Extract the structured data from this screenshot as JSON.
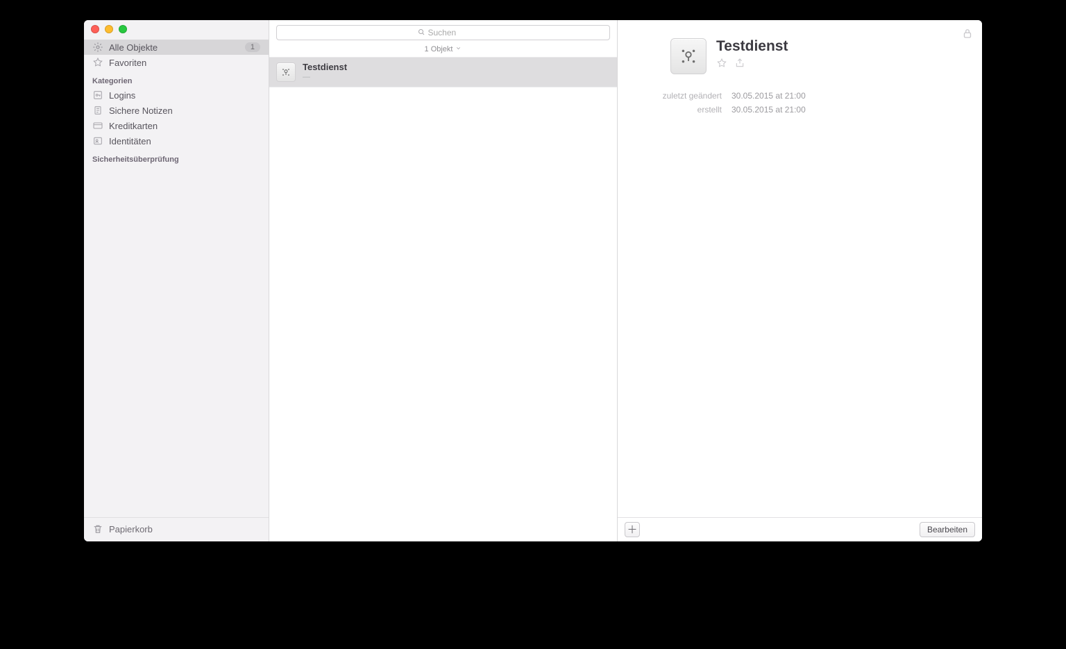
{
  "sidebar": {
    "all_items": {
      "label": "Alle Objekte",
      "count": "1"
    },
    "favorites": {
      "label": "Favoriten"
    },
    "categories_header": "Kategorien",
    "categories": {
      "logins": {
        "label": "Logins"
      },
      "secure_notes": {
        "label": "Sichere Notizen"
      },
      "credit_cards": {
        "label": "Kreditkarten"
      },
      "identities": {
        "label": "Identitäten"
      }
    },
    "security_audit_header": "Sicherheitsüberprüfung",
    "trash": {
      "label": "Papierkorb"
    }
  },
  "search": {
    "placeholder": "Suchen"
  },
  "list": {
    "count_label": "1 Objekt",
    "items": [
      {
        "title": "Testdienst",
        "subtitle": "—"
      }
    ]
  },
  "detail": {
    "title": "Testdienst",
    "modified": {
      "label": "zuletzt geändert",
      "value": "30.05.2015 at 21:00"
    },
    "created": {
      "label": "erstellt",
      "value": "30.05.2015 at 21:00"
    },
    "edit_button": "Bearbeiten"
  }
}
